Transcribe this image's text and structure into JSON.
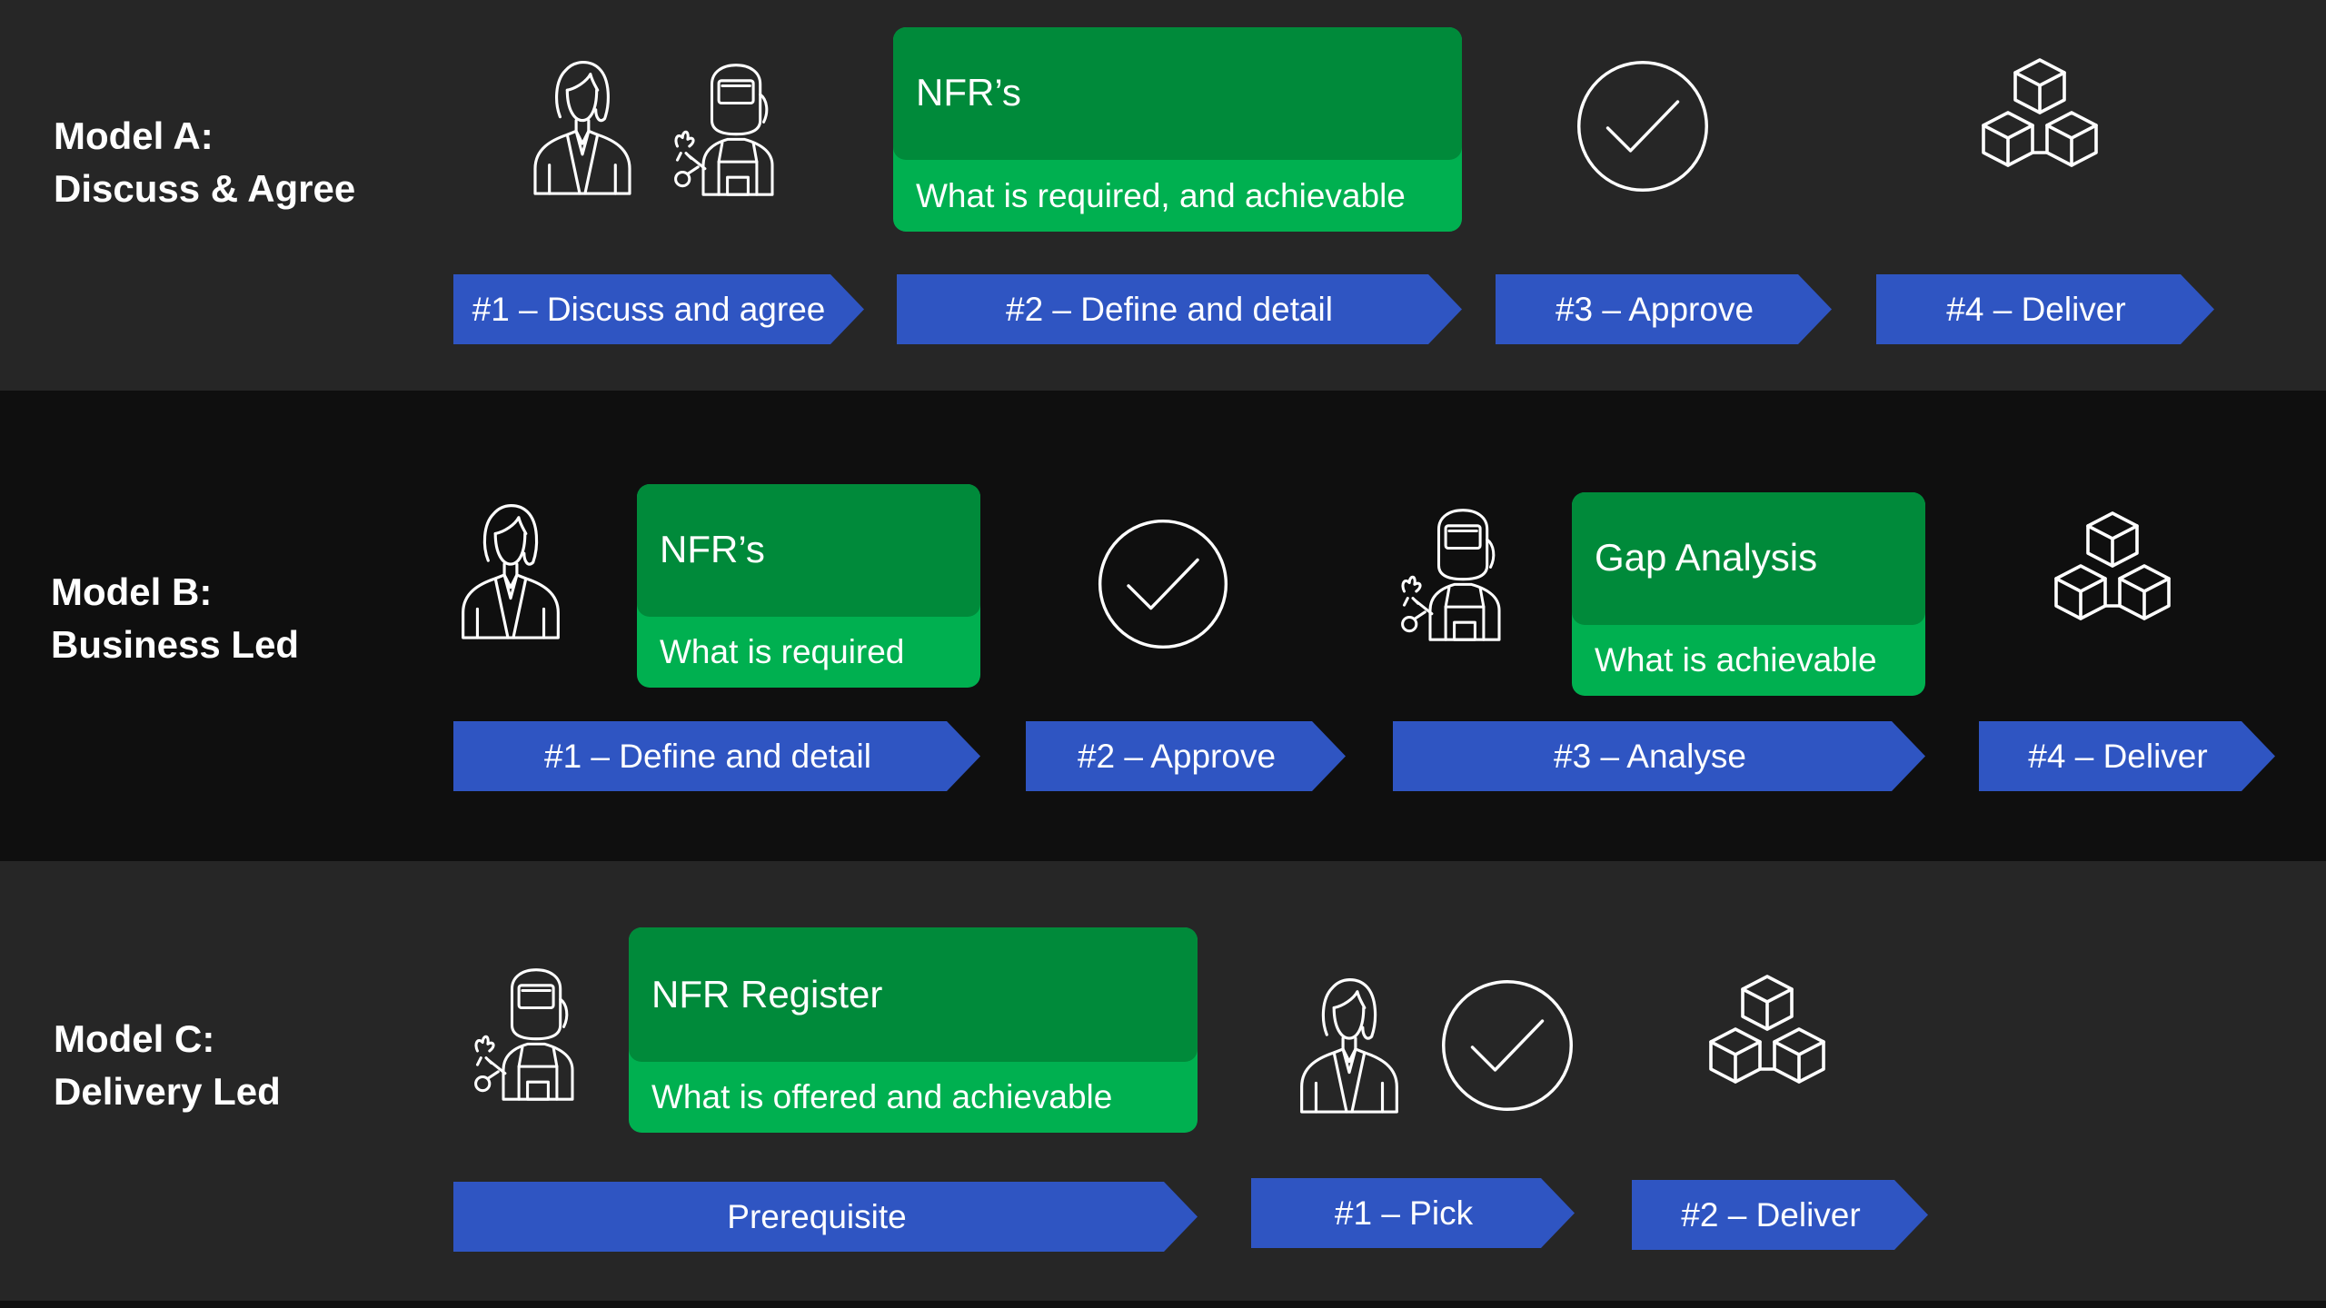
{
  "colors": {
    "arrow_fill": "#2f55c2",
    "card_head": "#008a3a",
    "card_body": "#00b050",
    "icon_stroke": "#ffffff"
  },
  "model_a": {
    "title_line1": "Model A:",
    "title_line2": "Discuss & Agree",
    "card": {
      "title": "NFR’s",
      "subtitle": "What is required, and achievable"
    },
    "steps": [
      "#1 – Discuss and agree",
      "#2 – Define and detail",
      "#3 – Approve",
      "#4 – Deliver"
    ],
    "icons": [
      "business-woman-icon",
      "welder-icon",
      "checkmark-circle-icon",
      "cubes-icon"
    ]
  },
  "model_b": {
    "title_line1": "Model B:",
    "title_line2": "Business Led",
    "card1": {
      "title": "NFR’s",
      "subtitle": "What is required"
    },
    "card2": {
      "title": "Gap Analysis",
      "subtitle": "What is achievable"
    },
    "steps": [
      "#1 – Define and detail",
      "#2 – Approve",
      "#3 – Analyse",
      "#4 – Deliver"
    ],
    "icons": [
      "business-woman-icon",
      "checkmark-circle-icon",
      "welder-icon",
      "cubes-icon"
    ]
  },
  "model_c": {
    "title_line1": "Model C:",
    "title_line2": "Delivery Led",
    "card": {
      "title": "NFR Register",
      "subtitle": "What is offered and achievable"
    },
    "steps": [
      "Prerequisite",
      "#1 – Pick",
      "#2 – Deliver"
    ],
    "icons": [
      "welder-icon",
      "business-woman-icon",
      "checkmark-circle-icon",
      "cubes-icon"
    ]
  }
}
